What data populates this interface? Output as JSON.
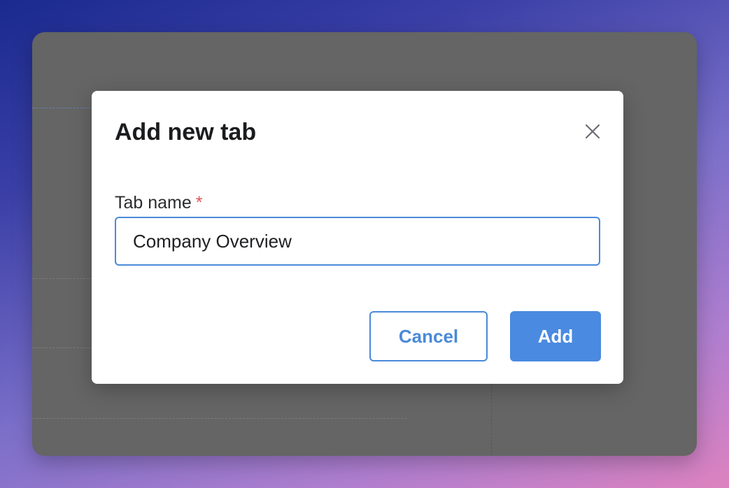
{
  "dialog": {
    "title": "Add new tab",
    "close_icon": "close-icon",
    "field": {
      "label": "Tab name",
      "required_mark": "*",
      "value": "Company Overview"
    },
    "buttons": {
      "cancel_label": "Cancel",
      "add_label": "Add"
    }
  },
  "colors": {
    "accent": "#4a8ae0",
    "required": "#e05656",
    "overlay": "#646564",
    "modal_background": "#ffffff"
  }
}
